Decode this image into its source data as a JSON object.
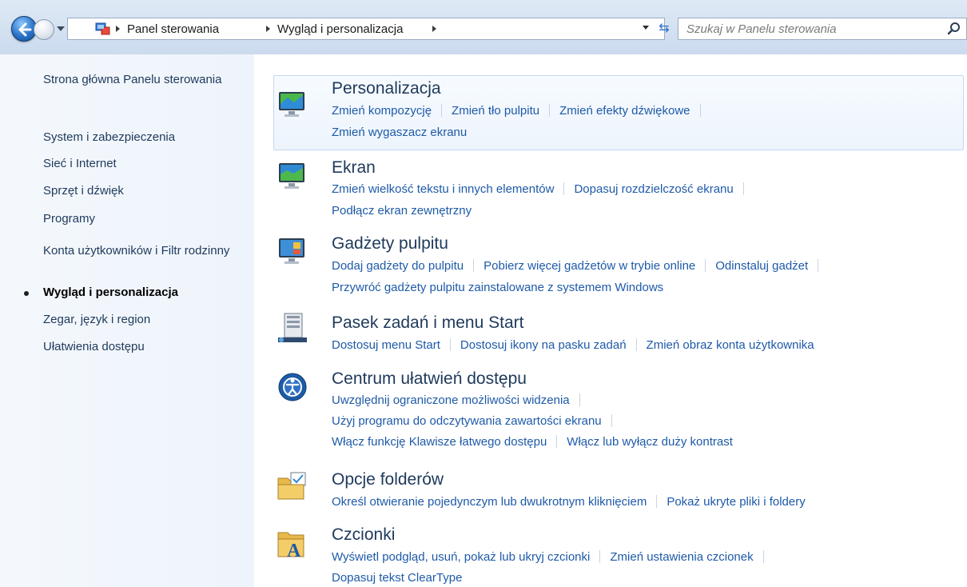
{
  "breadcrumb": {
    "items": [
      "Panel sterowania",
      "Wygląd i personalizacja"
    ]
  },
  "search": {
    "placeholder": "Szukaj w Panelu sterowania"
  },
  "sidebar": {
    "items": [
      {
        "label": "Strona główna Panelu sterowania"
      },
      {
        "label": "System i zabezpieczenia"
      },
      {
        "label": "Sieć i Internet"
      },
      {
        "label": "Sprzęt i dźwięk"
      },
      {
        "label": "Programy"
      },
      {
        "label": "Konta użytkowników i Filtr rodzinny"
      },
      {
        "label": "Wygląd i personalizacja",
        "current": true
      },
      {
        "label": "Zegar, język i region"
      },
      {
        "label": "Ułatwienia dostępu"
      }
    ]
  },
  "categories": [
    {
      "title": "Personalizacja",
      "icon": "personalization-icon",
      "rows": [
        [
          "Zmień kompozycję",
          "Zmień tło pulpitu",
          "Zmień efekty dźwiękowe"
        ],
        [
          "Zmień wygaszacz ekranu"
        ]
      ]
    },
    {
      "title": "Ekran",
      "icon": "display-icon",
      "rows": [
        [
          "Zmień wielkość tekstu i innych elementów",
          "Dopasuj rozdzielczość ekranu"
        ],
        [
          "Podłącz ekran zewnętrzny"
        ]
      ]
    },
    {
      "title": "Gadżety pulpitu",
      "icon": "gadgets-icon",
      "rows": [
        [
          "Dodaj gadżety do pulpitu",
          "Pobierz więcej gadżetów w trybie online",
          "Odinstaluj gadżet"
        ],
        [
          "Przywróć gadżety pulpitu zainstalowane z systemem Windows"
        ]
      ]
    },
    {
      "title": "Pasek zadań i menu Start",
      "icon": "taskbar-icon",
      "rows": [
        [
          "Dostosuj menu Start",
          "Dostosuj ikony na pasku zadań",
          "Zmień obraz konta użytkownika"
        ]
      ]
    },
    {
      "title": "Centrum ułatwień dostępu",
      "icon": "ease-of-access-icon",
      "rows": [
        [
          "Uwzględnij ograniczone możliwości widzenia"
        ],
        [
          "Użyj programu do odczytywania zawartości ekranu"
        ],
        [
          "Włącz funkcję Klawisze łatwego dostępu",
          "Włącz lub wyłącz duży kontrast"
        ]
      ]
    },
    {
      "title": "Opcje folderów",
      "icon": "folder-options-icon",
      "rows": [
        [
          "Określ otwieranie pojedynczym lub dwukrotnym kliknięciem",
          "Pokaż ukryte pliki i foldery"
        ]
      ]
    },
    {
      "title": "Czcionki",
      "icon": "fonts-icon",
      "rows": [
        [
          "Wyświetl podgląd, usuń, pokaż lub ukryj czcionki",
          "Zmień ustawienia czcionek"
        ],
        [
          "Dopasuj tekst ClearType"
        ]
      ]
    }
  ]
}
